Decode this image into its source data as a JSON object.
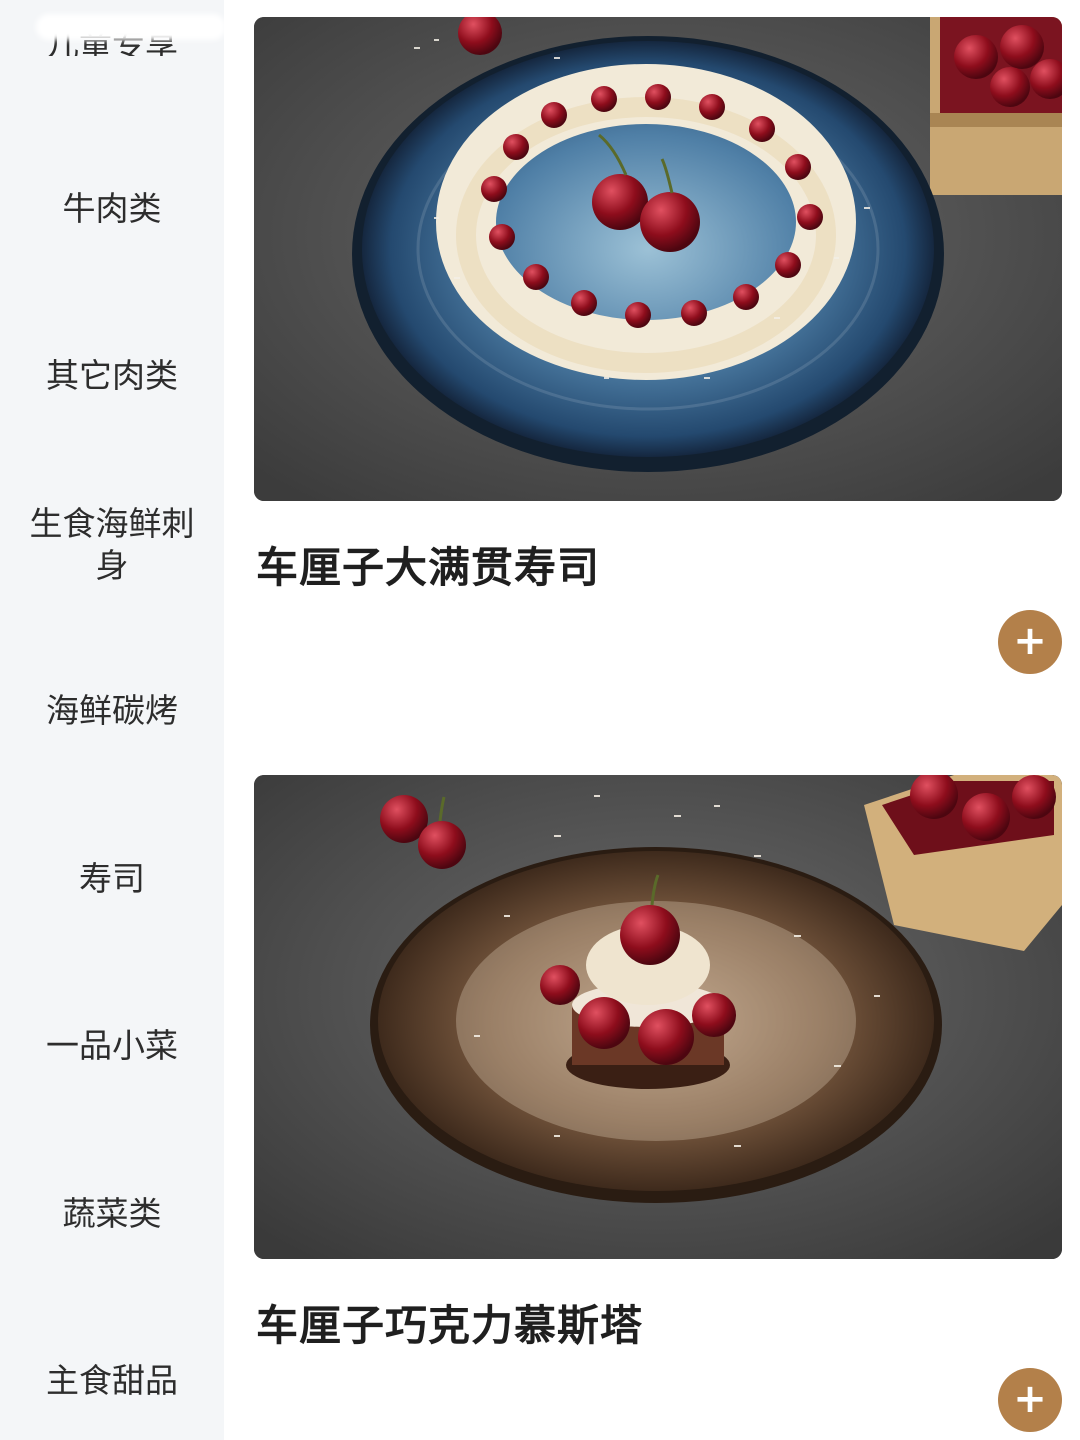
{
  "sidebar": {
    "partial_top_label": "儿童专享",
    "items": [
      {
        "label": "牛肉类"
      },
      {
        "label": "其它肉类"
      },
      {
        "label": "生食海鲜刺身"
      },
      {
        "label": "海鲜碳烤"
      },
      {
        "label": "寿司"
      },
      {
        "label": "一品小菜"
      },
      {
        "label": "蔬菜类"
      },
      {
        "label": "主食甜品"
      }
    ]
  },
  "dishes": [
    {
      "name": "车厘子大满贯寿司",
      "add_icon": "plus-icon"
    },
    {
      "name": "车厘子巧克力慕斯塔",
      "add_icon": "plus-icon"
    }
  ],
  "colors": {
    "sidebar_bg": "#f4f6f8",
    "add_button": "#b3804a",
    "text_primary": "#1f1f1f"
  }
}
